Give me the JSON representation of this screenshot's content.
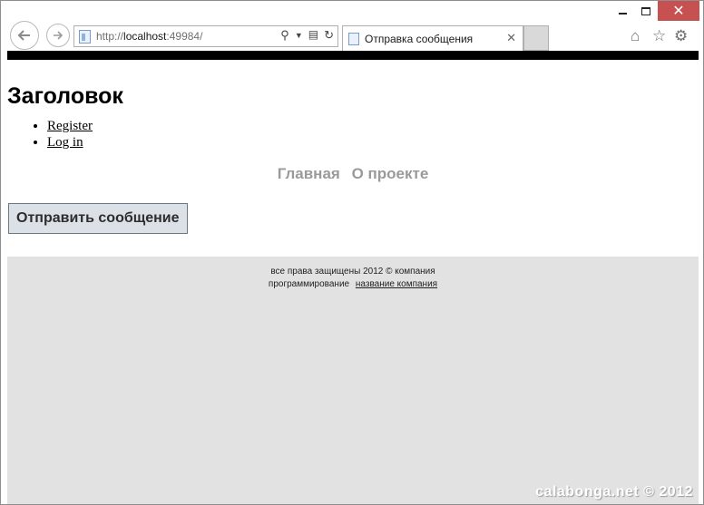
{
  "browser": {
    "address": {
      "scheme": "http://",
      "host": "localhost",
      "port": ":49984/"
    },
    "tab_title": "Отправка сообщения",
    "tab_close": "✕",
    "icons": [
      "back-arrow-icon",
      "forward-arrow-icon",
      "page-icon",
      "search-icon",
      "compatibility-icon",
      "refresh-icon",
      "home-icon",
      "favorites-star-icon",
      "gear-icon"
    ]
  },
  "page": {
    "heading": "Заголовок",
    "login_links": [
      {
        "label": "Register"
      },
      {
        "label": "Log in"
      }
    ],
    "menu": [
      {
        "label": "Главная"
      },
      {
        "label": "О проекте"
      }
    ],
    "send_button": "Отправить сообщение",
    "footer": {
      "copyright": "все права защищены 2012 © компания",
      "developer_prefix": "программирование",
      "developer_link": "название компания"
    }
  },
  "watermark": "calabonga.net © 2012",
  "colors": {
    "close_button": "#c75050",
    "footer_bg": "#e2e2e2",
    "menu_text": "#9a9a9a",
    "send_button_bg": "#dbe1e6"
  }
}
